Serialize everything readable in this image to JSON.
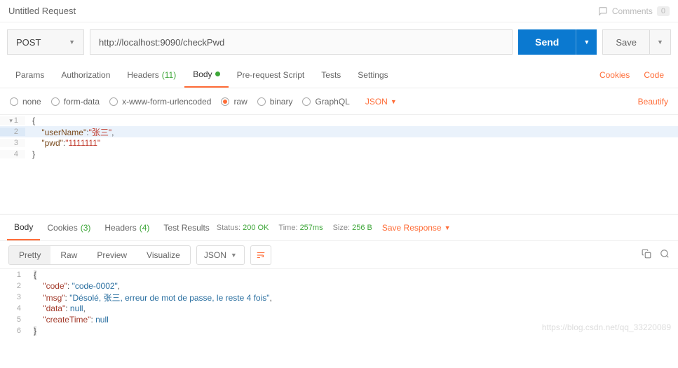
{
  "header": {
    "title": "Untitled Request",
    "commentsLabel": "Comments",
    "commentsCount": "0"
  },
  "request": {
    "method": "POST",
    "url": "http://localhost:9090/checkPwd",
    "sendLabel": "Send",
    "saveLabel": "Save"
  },
  "tabs": {
    "params": "Params",
    "authorization": "Authorization",
    "headers": "Headers",
    "headersCount": "(11)",
    "body": "Body",
    "preRequest": "Pre-request Script",
    "tests": "Tests",
    "settings": "Settings",
    "cookies": "Cookies",
    "code": "Code"
  },
  "bodySub": {
    "none": "none",
    "formData": "form-data",
    "urlencoded": "x-www-form-urlencoded",
    "raw": "raw",
    "binary": "binary",
    "graphql": "GraphQL",
    "lang": "JSON",
    "beautify": "Beautify"
  },
  "reqBody": {
    "l1": "{",
    "l2a": "\"userName\"",
    "l2b": ":",
    "l2c": "\"张三\"",
    "l2d": ",",
    "l3a": "\"pwd\"",
    "l3b": ":",
    "l3c": "\"1111111\"",
    "l4": "}"
  },
  "respTabs": {
    "body": "Body",
    "cookies": "Cookies",
    "cookiesCount": "(3)",
    "headers": "Headers",
    "headersCount": "(4)",
    "testResults": "Test Results"
  },
  "status": {
    "statusLabel": "Status:",
    "statusValue": "200 OK",
    "timeLabel": "Time:",
    "timeValue": "257ms",
    "sizeLabel": "Size:",
    "sizeValue": "256 B",
    "saveResponse": "Save Response"
  },
  "respToolbar": {
    "pretty": "Pretty",
    "raw": "Raw",
    "preview": "Preview",
    "visualize": "Visualize",
    "lang": "JSON"
  },
  "respBody": {
    "l1": "{",
    "l2k": "\"code\"",
    "l2v": "\"code-0002\"",
    "l3k": "\"msg\"",
    "l3v": "\"Désolé, 张三, erreur de mot de passe, le reste 4 fois\"",
    "l4k": "\"data\"",
    "l4v": "null",
    "l5k": "\"createTime\"",
    "l5v": "null",
    "l6": "}"
  },
  "watermark": "https://blog.csdn.net/qq_33220089"
}
